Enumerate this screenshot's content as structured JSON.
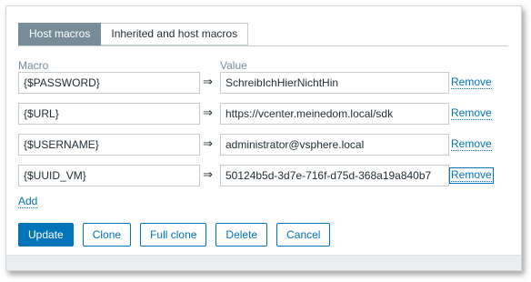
{
  "tabs": [
    {
      "label": "Host macros",
      "active": true
    },
    {
      "label": "Inherited and host macros",
      "active": false
    }
  ],
  "columns": {
    "macro": "Macro",
    "value": "Value"
  },
  "arrow_glyph": "⇒",
  "macros": [
    {
      "macro": "{$PASSWORD}",
      "value": "SchreibIchHierNichtHin",
      "remove": "Remove"
    },
    {
      "macro": "{$URL}",
      "value": "https://vcenter.meinedom.local/sdk",
      "remove": "Remove"
    },
    {
      "macro": "{$USERNAME}",
      "value": "administrator@vsphere.local",
      "remove": "Remove"
    },
    {
      "macro": "{$UUID_VM}",
      "value": "50124b5d-3d7e-716f-d75d-368a19a840b7",
      "remove": "Remove"
    }
  ],
  "add_label": "Add",
  "buttons": {
    "update": "Update",
    "clone": "Clone",
    "full_clone": "Full clone",
    "delete": "Delete",
    "cancel": "Cancel"
  },
  "colors": {
    "accent": "#0275b8",
    "tab_active": "#768d99"
  }
}
